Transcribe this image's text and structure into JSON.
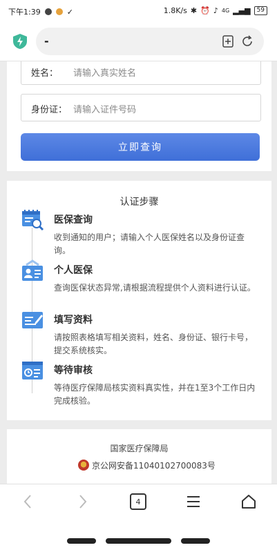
{
  "status_bar": {
    "time": "下午1:39",
    "speed": "1.8K/s",
    "signal": "4G",
    "battery": "59"
  },
  "browser": {
    "url_text": "-"
  },
  "form": {
    "name_label": "姓名：",
    "name_placeholder": "请输入真实姓名",
    "id_label": "身份证：",
    "id_placeholder": "请输入证件号码",
    "submit_label": "立即查询"
  },
  "steps": {
    "title": "认证步骤",
    "items": [
      {
        "title": "医保查询",
        "desc": "收到通知的用户；请输入个人医保姓名以及身份证查询。",
        "icon": "search-document-icon"
      },
      {
        "title": "个人医保",
        "desc": "查询医保状态异常,请根据流程提供个人资料进行认证。",
        "icon": "id-card-icon"
      },
      {
        "title": "填写资料",
        "desc": "请按照表格填写相关资料，姓名、身份证、银行卡号，提交系统核实。",
        "icon": "edit-form-icon"
      },
      {
        "title": "等待审核",
        "desc": "等待医疗保障局核实资料真实性，并在1至3个工作日内完成核验。",
        "icon": "clock-card-icon"
      }
    ]
  },
  "footer": {
    "org": "国家医疗保障局",
    "icp": "京公网安备11040102700083号"
  },
  "nav": {
    "tab_count": "4"
  },
  "colors": {
    "accent": "#3f6fd8",
    "icon_blue": "#4a90e2"
  }
}
